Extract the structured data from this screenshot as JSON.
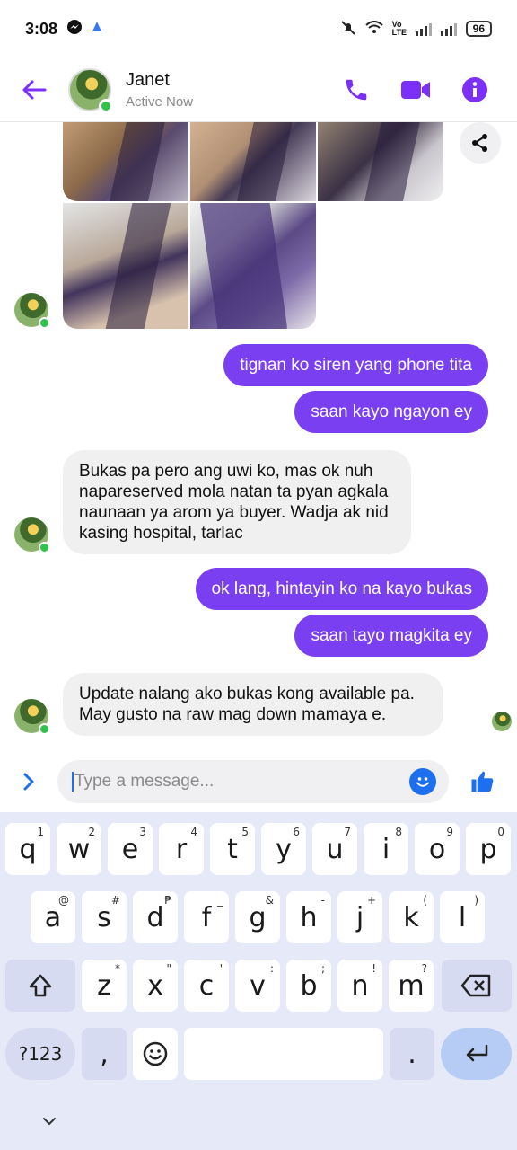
{
  "status_bar": {
    "time": "3:08",
    "battery": "96",
    "network_label": "Vo LTE"
  },
  "header": {
    "contact_name": "Janet",
    "contact_status": "Active Now"
  },
  "messages": [
    {
      "direction": "in",
      "type": "photos",
      "count": 5
    },
    {
      "direction": "out",
      "text": "tignan ko siren yang phone tita"
    },
    {
      "direction": "out",
      "text": "saan kayo ngayon ey"
    },
    {
      "direction": "in",
      "text": "Bukas pa pero ang uwi ko, mas ok nuh napareserved mola natan ta pyan agkala naunaan ya arom ya buyer. Wadja ak nid kasing hospital, tarlac"
    },
    {
      "direction": "out",
      "text": "ok lang, hintayin ko na kayo bukas"
    },
    {
      "direction": "out",
      "text": "saan tayo magkita ey"
    },
    {
      "direction": "in",
      "text": "Update nalang ako bukas kong available pa. May gusto na raw mag down mamaya e."
    }
  ],
  "composer": {
    "placeholder": "Type a message..."
  },
  "keyboard": {
    "row1": [
      {
        "k": "q",
        "h": "1"
      },
      {
        "k": "w",
        "h": "2"
      },
      {
        "k": "e",
        "h": "3"
      },
      {
        "k": "r",
        "h": "4"
      },
      {
        "k": "t",
        "h": "5"
      },
      {
        "k": "y",
        "h": "6"
      },
      {
        "k": "u",
        "h": "7"
      },
      {
        "k": "i",
        "h": "8"
      },
      {
        "k": "o",
        "h": "9"
      },
      {
        "k": "p",
        "h": "0"
      }
    ],
    "row2": [
      {
        "k": "a",
        "h": "@"
      },
      {
        "k": "s",
        "h": "#"
      },
      {
        "k": "d",
        "h": "₱"
      },
      {
        "k": "f",
        "h": "_"
      },
      {
        "k": "g",
        "h": "&"
      },
      {
        "k": "h",
        "h": "-"
      },
      {
        "k": "j",
        "h": "+"
      },
      {
        "k": "k",
        "h": "("
      },
      {
        "k": "l",
        "h": ")"
      }
    ],
    "row3": [
      {
        "k": "z",
        "h": "*"
      },
      {
        "k": "x",
        "h": "\""
      },
      {
        "k": "c",
        "h": "'"
      },
      {
        "k": "v",
        "h": ":"
      },
      {
        "k": "b",
        "h": ";"
      },
      {
        "k": "n",
        "h": "!"
      },
      {
        "k": "m",
        "h": "?"
      }
    ],
    "sym_label": "?123",
    "comma": ",",
    "period": "."
  }
}
